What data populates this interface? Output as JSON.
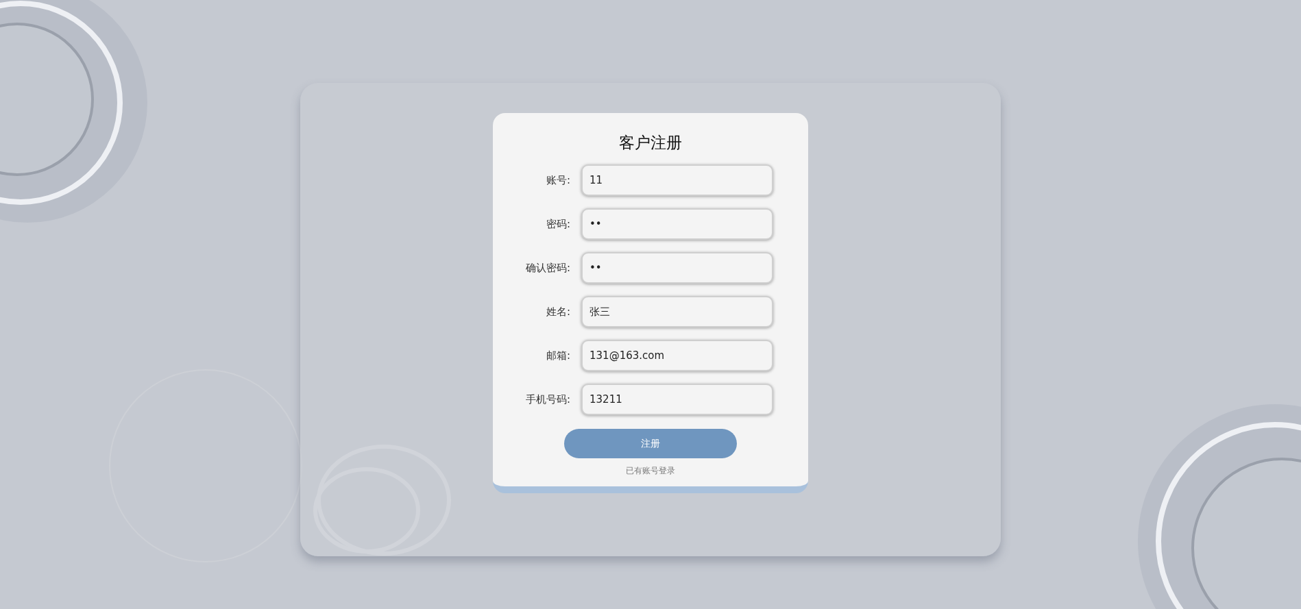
{
  "form": {
    "title": "客户注册",
    "fields": [
      {
        "label": "账号:",
        "value": "11"
      },
      {
        "label": "密码:",
        "value": "••"
      },
      {
        "label": "确认密码:",
        "value": "••"
      },
      {
        "label": "姓名:",
        "value": "张三"
      },
      {
        "label": "邮箱:",
        "value": "131@163.com"
      },
      {
        "label": "手机号码:",
        "value": "13211"
      }
    ],
    "submit": "注册",
    "login_link": "已有账号登录"
  }
}
